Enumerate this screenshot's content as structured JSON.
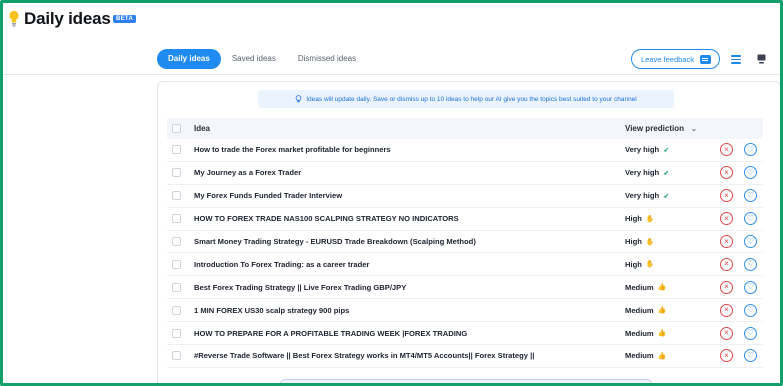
{
  "header": {
    "title": "Daily ideas",
    "badge": "BETA",
    "accent_color": "#1f8bf0",
    "frame_color": "#11a06b"
  },
  "tabs": [
    {
      "label": "Daily ideas",
      "active": true
    },
    {
      "label": "Saved ideas",
      "active": false
    },
    {
      "label": "Dismissed ideas",
      "active": false
    }
  ],
  "toolbar": {
    "feedback_label": "Leave feedback",
    "feedback_icon": "chat-icon",
    "list_view_icon": "list-view-icon",
    "card_view_icon": "card-view-icon"
  },
  "banner": {
    "icon": "lightbulb-icon",
    "text": "Ideas will update daily. Save or dismiss up to 10 ideas to help our AI give you the topics best suited to your channel"
  },
  "table": {
    "columns": {
      "idea": "Idea",
      "prediction": "View prediction"
    },
    "rows": [
      {
        "idea": "How to trade the Forex market profitable for beginners",
        "prediction": "Very high",
        "icon": "rocket-icon"
      },
      {
        "idea": "My Journey as a Forex Trader",
        "prediction": "Very high",
        "icon": "rocket-icon"
      },
      {
        "idea": "My Forex Funds Funded Trader Interview",
        "prediction": "Very high",
        "icon": "rocket-icon"
      },
      {
        "idea": "HOW TO FOREX TRADE NAS100 SCALPING STRATEGY NO INDICATORS",
        "prediction": "High",
        "icon": "hand-icon"
      },
      {
        "idea": "Smart Money Trading Strategy - EURUSD Trade Breakdown (Scalping Method)",
        "prediction": "High",
        "icon": "hand-icon"
      },
      {
        "idea": "Introduction To Forex Trading: as a career trader",
        "prediction": "High",
        "icon": "hand-icon"
      },
      {
        "idea": "Best Forex Trading Strategy || Live Forex Trading GBP/JPY",
        "prediction": "Medium",
        "icon": "thumbs-up-icon"
      },
      {
        "idea": "1 MIN FOREX US30 scalp strategy 900 pips",
        "prediction": "Medium",
        "icon": "thumbs-up-icon"
      },
      {
        "idea": "HOW TO PREPARE FOR A PROFITABLE TRADING WEEK |FOREX TRADING",
        "prediction": "Medium",
        "icon": "thumbs-up-icon"
      },
      {
        "idea": "#Reverse Trade Software || Best Forex Strategy works in MT4/MT5 Accounts|| Forex Strategy ||",
        "prediction": "Medium",
        "icon": "thumbs-up-icon"
      }
    ]
  }
}
